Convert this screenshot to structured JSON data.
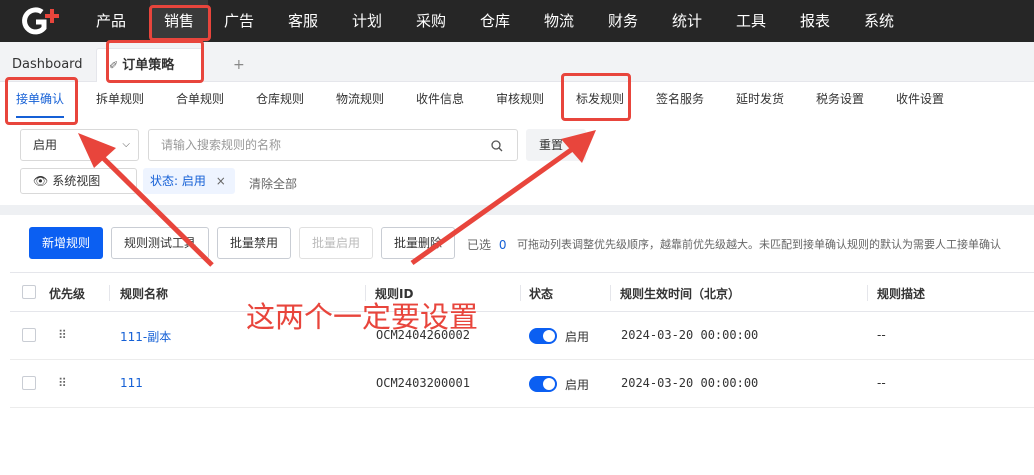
{
  "topnav": {
    "items": [
      "产品",
      "销售",
      "广告",
      "客服",
      "计划",
      "采购",
      "仓库",
      "物流",
      "财务",
      "统计",
      "工具",
      "报表",
      "系统"
    ],
    "active_index": 1,
    "brand_color": "#e8453c"
  },
  "tabs": {
    "dashboard": "Dashboard",
    "active": "订单策略",
    "add": "+"
  },
  "subnav": {
    "items": [
      "接单确认",
      "拆单规则",
      "合单规则",
      "仓库规则",
      "物流规则",
      "收件信息",
      "审核规则",
      "标发规则",
      "签名服务",
      "延时发货",
      "税务设置",
      "收件设置"
    ],
    "active_index": 0
  },
  "filters": {
    "status_select": "启用",
    "search_placeholder": "请输入搜索规则的名称",
    "reset_label": "重置",
    "view_label": "系统视图",
    "status_chip_key": "状态:",
    "status_chip_value": "启用",
    "clear_all": "清除全部"
  },
  "toolbar": {
    "add_rule": "新增规则",
    "test_tool": "规则测试工具",
    "batch_disable": "批量禁用",
    "batch_enable": "批量启用",
    "batch_delete": "批量删除",
    "selected_prefix": "已选",
    "selected_count": "0",
    "hint": "可拖动列表调整优先级顺序，越靠前优先级越大。未匹配到接单确认规则的默认为需要人工接单确认"
  },
  "table": {
    "headers": [
      "优先级",
      "规则名称",
      "规则ID",
      "状态",
      "规则生效时间（北京）",
      "规则描述"
    ],
    "rows": [
      {
        "name": "111-副本",
        "id": "OCM2404260002",
        "status": "启用",
        "time": "2024-03-20 00:00:00",
        "desc": "--"
      },
      {
        "name": "111",
        "id": "OCM2403200001",
        "status": "启用",
        "time": "2024-03-20 00:00:00",
        "desc": "--"
      }
    ]
  },
  "annotation": {
    "text": "这两个一定要设置",
    "color": "#e8453c"
  }
}
